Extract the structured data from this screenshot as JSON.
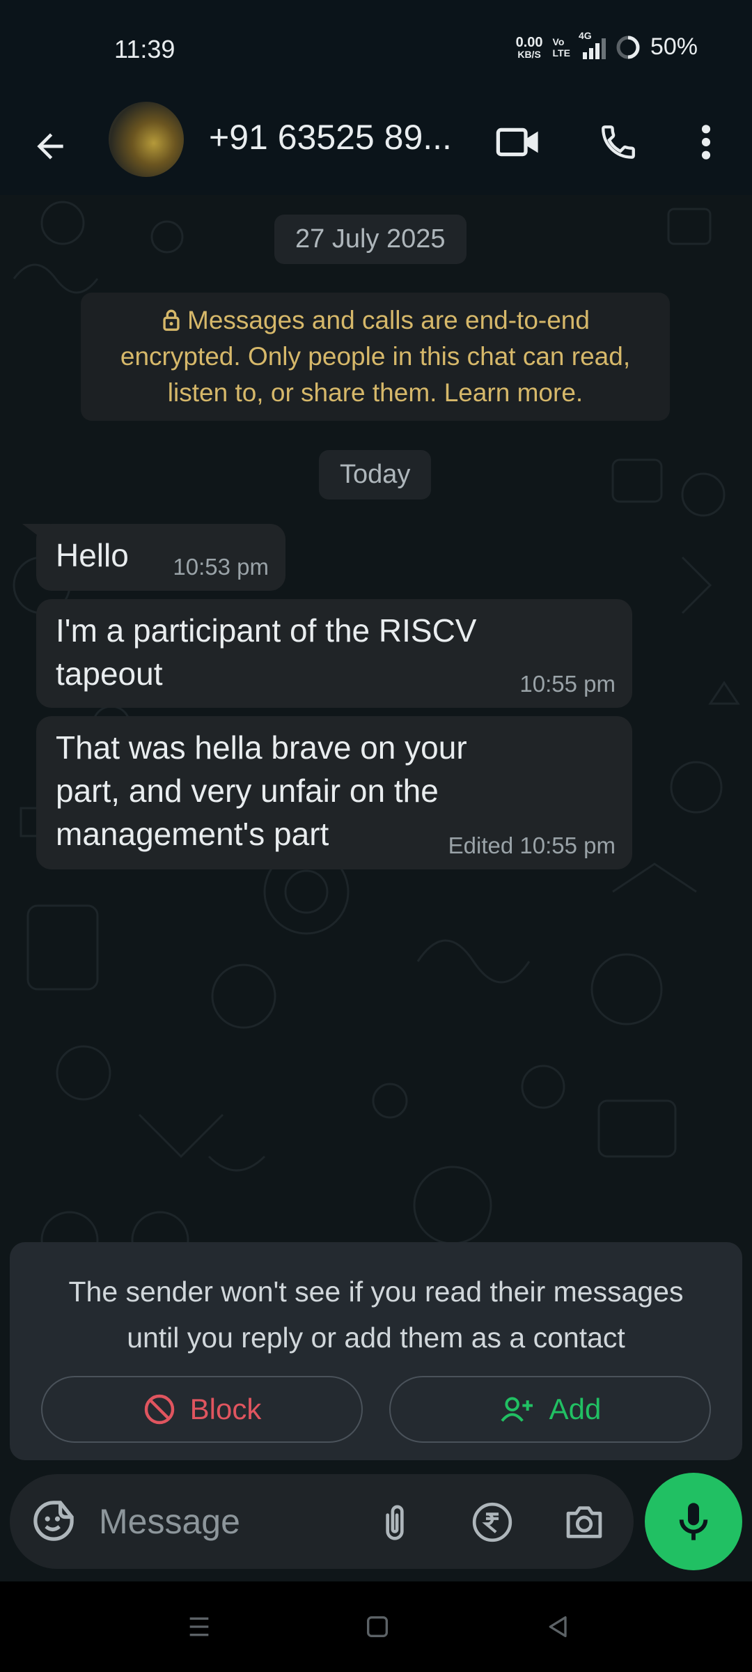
{
  "status_bar": {
    "time": "11:39",
    "net_speed_value": "0.00",
    "net_speed_unit": "KB/S",
    "volte_top": "Vo",
    "volte_bottom": "LTE",
    "network": "4G",
    "battery": "50%"
  },
  "header": {
    "contact_name": "+91 63525 89..."
  },
  "chat": {
    "date_divider": "27 July 2025",
    "encryption_notice": "Messages and calls are end-to-end encrypted. Only people in this chat can read, listen to, or share them. Learn more.",
    "today_divider": "Today",
    "messages": [
      {
        "text": "Hello",
        "time": "10:53 pm"
      },
      {
        "text": "I'm a participant of the RISCV tapeout",
        "time": "10:55 pm"
      },
      {
        "text": "That was hella brave on your part, and very unfair on the management's part",
        "time": "Edited 10:55 pm"
      }
    ]
  },
  "sender_card": {
    "text": "The sender won't see if you read their messages until you reply or add them as a contact",
    "block_label": "Block",
    "add_label": "Add"
  },
  "composer": {
    "placeholder": "Message"
  },
  "colors": {
    "accent_green": "#21c063",
    "block_red": "#e0555f",
    "notice_yellow": "#d6b86a"
  }
}
